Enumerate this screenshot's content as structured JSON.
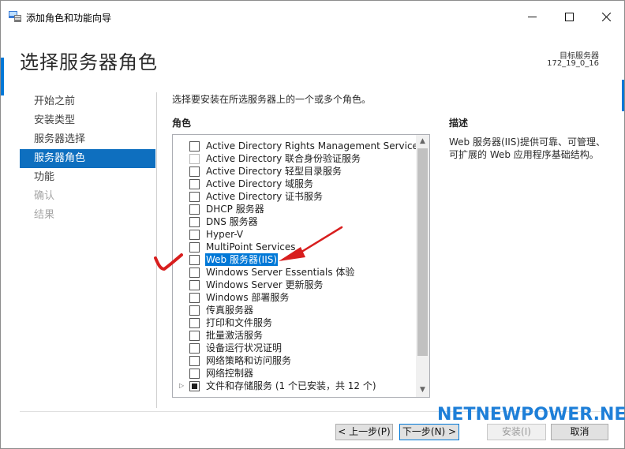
{
  "window": {
    "title": "添加角色和功能向导",
    "min_icon": "minimize-icon",
    "max_icon": "maximize-icon",
    "close_icon": "close-icon"
  },
  "header": {
    "page_title": "选择服务器角色",
    "target_label": "目标服务器",
    "target_value": "172_19_0_16"
  },
  "nav": {
    "items": [
      {
        "label": "开始之前",
        "state": "normal"
      },
      {
        "label": "安装类型",
        "state": "normal"
      },
      {
        "label": "服务器选择",
        "state": "normal"
      },
      {
        "label": "服务器角色",
        "state": "active"
      },
      {
        "label": "功能",
        "state": "normal"
      },
      {
        "label": "确认",
        "state": "disabled"
      },
      {
        "label": "结果",
        "state": "disabled"
      }
    ]
  },
  "main": {
    "instruction": "选择要安装在所选服务器上的一个或多个角色。",
    "roles_heading": "角色",
    "roles": [
      {
        "label": "Active Directory Rights Management Services",
        "checked": "no"
      },
      {
        "label": "Active Directory 联合身份验证服务",
        "checked": "no"
      },
      {
        "label": "Active Directory 轻型目录服务",
        "checked": "no"
      },
      {
        "label": "Active Directory 域服务",
        "checked": "no"
      },
      {
        "label": "Active Directory 证书服务",
        "checked": "no"
      },
      {
        "label": "DHCP 服务器",
        "checked": "no"
      },
      {
        "label": "DNS 服务器",
        "checked": "no"
      },
      {
        "label": "Hyper-V",
        "checked": "no"
      },
      {
        "label": "MultiPoint Services",
        "checked": "no"
      },
      {
        "label": "Web 服务器(IIS)",
        "checked": "no",
        "selected": true
      },
      {
        "label": "Windows Server Essentials 体验",
        "checked": "no"
      },
      {
        "label": "Windows Server 更新服务",
        "checked": "no"
      },
      {
        "label": "Windows 部署服务",
        "checked": "no"
      },
      {
        "label": "传真服务器",
        "checked": "no"
      },
      {
        "label": "打印和文件服务",
        "checked": "no"
      },
      {
        "label": "批量激活服务",
        "checked": "no"
      },
      {
        "label": "设备运行状况证明",
        "checked": "no"
      },
      {
        "label": "网络策略和访问服务",
        "checked": "no"
      },
      {
        "label": "网络控制器",
        "checked": "no"
      },
      {
        "label": "文件和存储服务 (1 个已安装，共 12 个)",
        "checked": "partial",
        "expandable": true
      }
    ]
  },
  "description": {
    "heading": "描述",
    "text": "Web 服务器(IIS)提供可靠、可管理、可扩展的 Web 应用程序基础结构。"
  },
  "footer": {
    "prev_label": "< 上一步(P)",
    "next_label": "下一步(N) >",
    "install_label": "安装(I)",
    "cancel_label": "取消"
  },
  "watermark": "NETNEWPOWER.NET",
  "colors": {
    "accent": "#0078d7",
    "nav_active": "#0e6fbf",
    "annotation": "#d81e1e",
    "watermark": "#1e7fd8"
  }
}
